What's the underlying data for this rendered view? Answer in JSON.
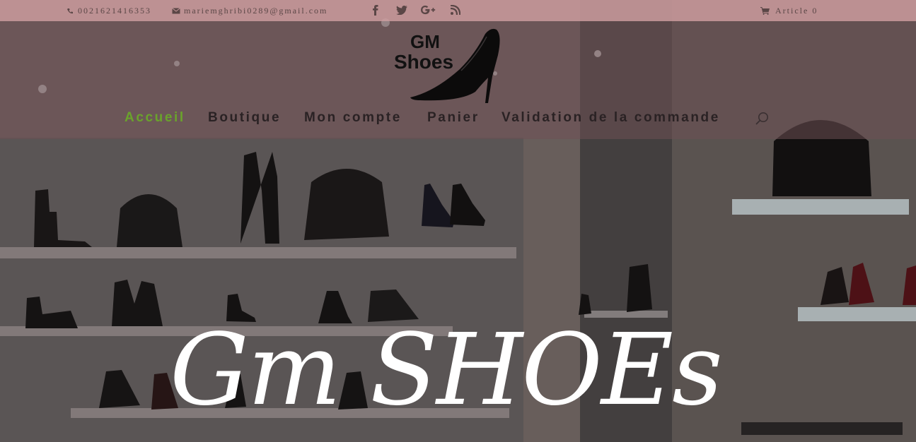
{
  "topbar": {
    "phone": "0021621416353",
    "email": "mariemghribi0289@gmail.com",
    "social_icons": [
      "facebook-icon",
      "twitter-icon",
      "google-plus-icon",
      "rss-icon"
    ],
    "cart_label": "Article 0"
  },
  "header": {
    "logo": {
      "line1": "GM",
      "line2": "Shoes"
    },
    "nav": [
      {
        "label": "Accueil",
        "active": true
      },
      {
        "label": "Boutique",
        "active": false
      },
      {
        "label": "Mon compte",
        "active": false
      },
      {
        "label": "Panier",
        "active": false
      },
      {
        "label": "Validation de la commande",
        "active": false
      }
    ],
    "search_icon": "search-icon"
  },
  "hero": {
    "title": "Gm SHOEs"
  },
  "colors": {
    "topbar_bg": "#c49698",
    "active_nav": "#6aa32b",
    "nav_text": "#2a2224",
    "title": "#ffffff"
  }
}
